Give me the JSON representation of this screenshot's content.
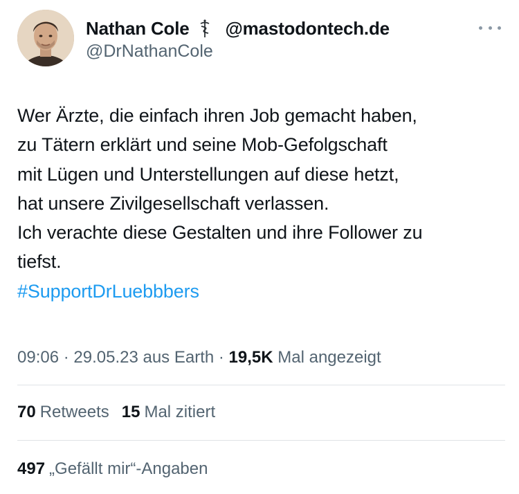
{
  "user": {
    "display_name": "Nathan Cole",
    "badge_icon": "caduceus-icon",
    "name_suffix": "@mastodontech.de",
    "handle": "@DrNathanCole",
    "more_icon": "more-icon"
  },
  "tweet": {
    "lines": [
      "Wer Ärzte, die einfach ihren Job gemacht haben,",
      "zu Tätern erklärt und seine Mob-Gefolgschaft",
      "mit Lügen und Unterstellungen auf diese hetzt,",
      "hat unsere Zivilgesellschaft verlassen.",
      "Ich verachte diese Gestalten und ihre Follower zu",
      "tiefst."
    ],
    "hashtag": "#SupportDrLuebbbers",
    "hashtag_color": "#1d9bf0"
  },
  "meta": {
    "time": "09:06",
    "sep1": " · ",
    "date": "29.05.23",
    "source": " aus Earth",
    "sep2": " · ",
    "views": "19,5K",
    "views_label": " Mal angezeigt"
  },
  "stats": {
    "retweets_count": "70",
    "retweets_label": "Retweets",
    "quotes_count": "15",
    "quotes_label": "Mal zitiert",
    "likes_count": "497",
    "likes_label": "„Gefällt mir“-Angaben"
  },
  "colors": {
    "text": "#0f1419",
    "secondary": "#536471",
    "divider": "#dfe3e6"
  }
}
